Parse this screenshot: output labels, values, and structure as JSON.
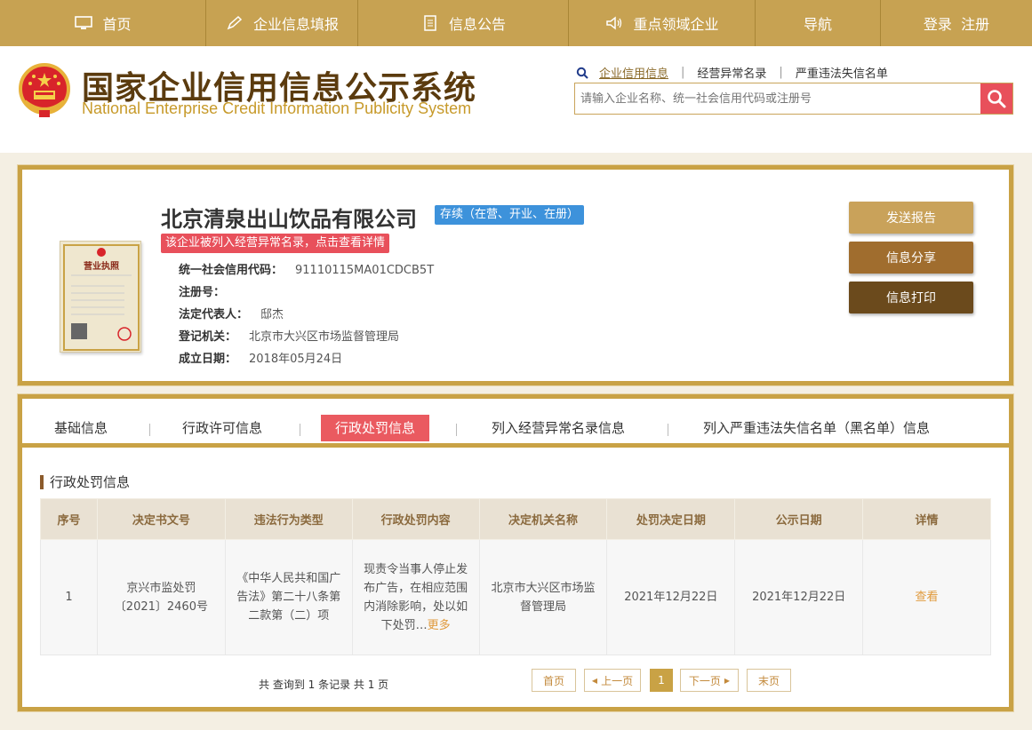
{
  "nav": [
    {
      "label": "首页",
      "icon": "monitor-icon"
    },
    {
      "label": "企业信息填报",
      "icon": "pen-icon"
    },
    {
      "label": "信息公告",
      "icon": "document-icon"
    },
    {
      "label": "重点领域企业",
      "icon": "speaker-icon"
    },
    {
      "label": "导航",
      "icon": ""
    },
    {
      "label": "登录  注册",
      "icon": ""
    }
  ],
  "header": {
    "title_cn": "国家企业信用信息公示系统",
    "title_en": "National Enterprise Credit Information Publicity System",
    "search_tabs": [
      "企业信用信息",
      "经营异常名录",
      "严重违法失信名单"
    ],
    "search_placeholder": "请输入企业名称、统一社会信用代码或注册号"
  },
  "company": {
    "name": "北京清泉出山饮品有限公司",
    "status": "存续（在营、开业、在册）",
    "warning": "该企业被列入经营异常名录，点击查看详情",
    "license_title": "营业执照",
    "fields": [
      {
        "label": "统一社会信用代码：",
        "value": "91110115MA01CDCB5T"
      },
      {
        "label": "注册号：",
        "value": ""
      },
      {
        "label": "法定代表人：",
        "value": "邸杰"
      },
      {
        "label": "登记机关：",
        "value": "北京市大兴区市场监督管理局"
      },
      {
        "label": "成立日期：",
        "value": "2018年05月24日"
      }
    ],
    "buttons": [
      "发送报告",
      "信息分享",
      "信息打印"
    ],
    "button_colors": [
      "#c9a25a",
      "#a06d2e",
      "#6b4a1c"
    ]
  },
  "tabs": [
    "基础信息",
    "行政许可信息",
    "行政处罚信息",
    "列入经营异常名录信息",
    "列入严重违法失信名单（黑名单）信息"
  ],
  "active_tab": "行政处罚信息",
  "section_title": "行政处罚信息",
  "table": {
    "headers": [
      "序号",
      "决定书文号",
      "违法行为类型",
      "行政处罚内容",
      "决定机关名称",
      "处罚决定日期",
      "公示日期",
      "详情"
    ],
    "rows": [
      {
        "no": "1",
        "doc": "京兴市监处罚〔2021〕2460号",
        "type": "《中华人民共和国广告法》第二十八条第二款第（二）项",
        "content": "现责令当事人停止发布广告，在相应范围内消除影响，处以如下处罚…",
        "more": "更多",
        "authority": "北京市大兴区市场监督管理局",
        "decision_date": "2021年12月22日",
        "publish_date": "2021年12月22日",
        "detail": "查看"
      }
    ]
  },
  "pager": {
    "summary": "共 查询到 1 条记录 共 1 页",
    "first": "首页",
    "prev": "上一页",
    "current": "1",
    "next": "下一页",
    "last": "末页"
  }
}
